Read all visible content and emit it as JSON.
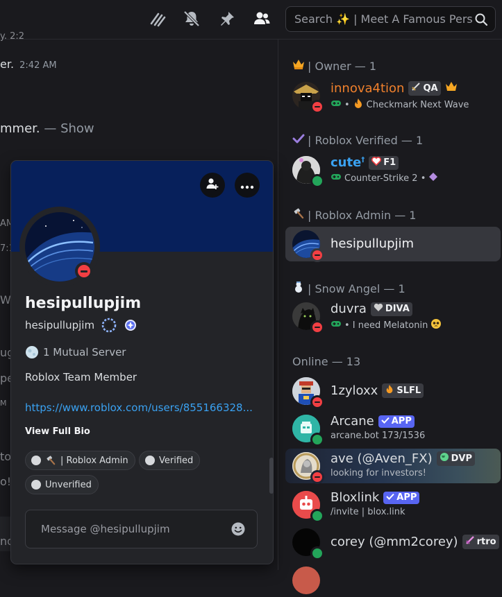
{
  "search": {
    "placeholder": "Search ✨ | Meet A Famous Pers..."
  },
  "chat": {
    "frag_1": "y. 2:2",
    "frag_2_text": "er.",
    "frag_2_time": "2:42 AM",
    "frag_3_text": "mmer.",
    "frag_3_link": "— Show",
    "frag_4": "AM",
    "frag_5": "7:1",
    "frag_6": "We",
    "frag_7": "ug",
    "frag_8": "pea",
    "frag_9": "M",
    "frag_10": "to",
    "frag_11": "o!",
    "frag_12": "nd"
  },
  "members": {
    "sections": {
      "owner": "| Owner — 1",
      "verified": "| Roblox Verified — 1",
      "admin": "| Roblox Admin — 1",
      "snow": "| Snow Angel — 1",
      "online": "Online — 13"
    },
    "list": [
      {
        "name": "innova4tion",
        "tag": "QA",
        "status": "Checkmark Next Wave"
      },
      {
        "name": "cute",
        "name_sup": "†",
        "tag": "F1",
        "status": "Counter-Strike 2 •"
      },
      {
        "name": "hesipullupjim"
      },
      {
        "name": "duvra",
        "tag": "DIVA",
        "status": "• I need Melatonin"
      },
      {
        "name": "1zyloxx",
        "tag": "SLFL"
      },
      {
        "name": "Arcane",
        "tag": "APP",
        "status": "arcane.bot 173/1536"
      },
      {
        "name": "ave (@Aven_FX)",
        "tag": "DVP",
        "status": "looking for investors!"
      },
      {
        "name": "Bloxlink",
        "tag": "APP",
        "status": "/invite | blox.link"
      },
      {
        "name": "corey (@mm2corey)",
        "tag": "rtro"
      }
    ]
  },
  "profile": {
    "display_name": "hesipullupjim",
    "username": "hesipullupjim",
    "mutual": "1 Mutual Server",
    "bio": "Roblox Team Member",
    "link": "https://www.roblox.com/users/855166328...",
    "view_full_bio": "View Full Bio",
    "roles": [
      "| Roblox Admin",
      "Verified",
      "Unverified"
    ],
    "message_placeholder": "Message @hesipullupjim"
  },
  "colors": {
    "accent_blurple": "#5865f2",
    "owner_name": "#f0802c",
    "verified_name": "#3aa2f2",
    "dnd": "#f23f43",
    "online": "#23a55a",
    "link": "#3aa2f2"
  }
}
